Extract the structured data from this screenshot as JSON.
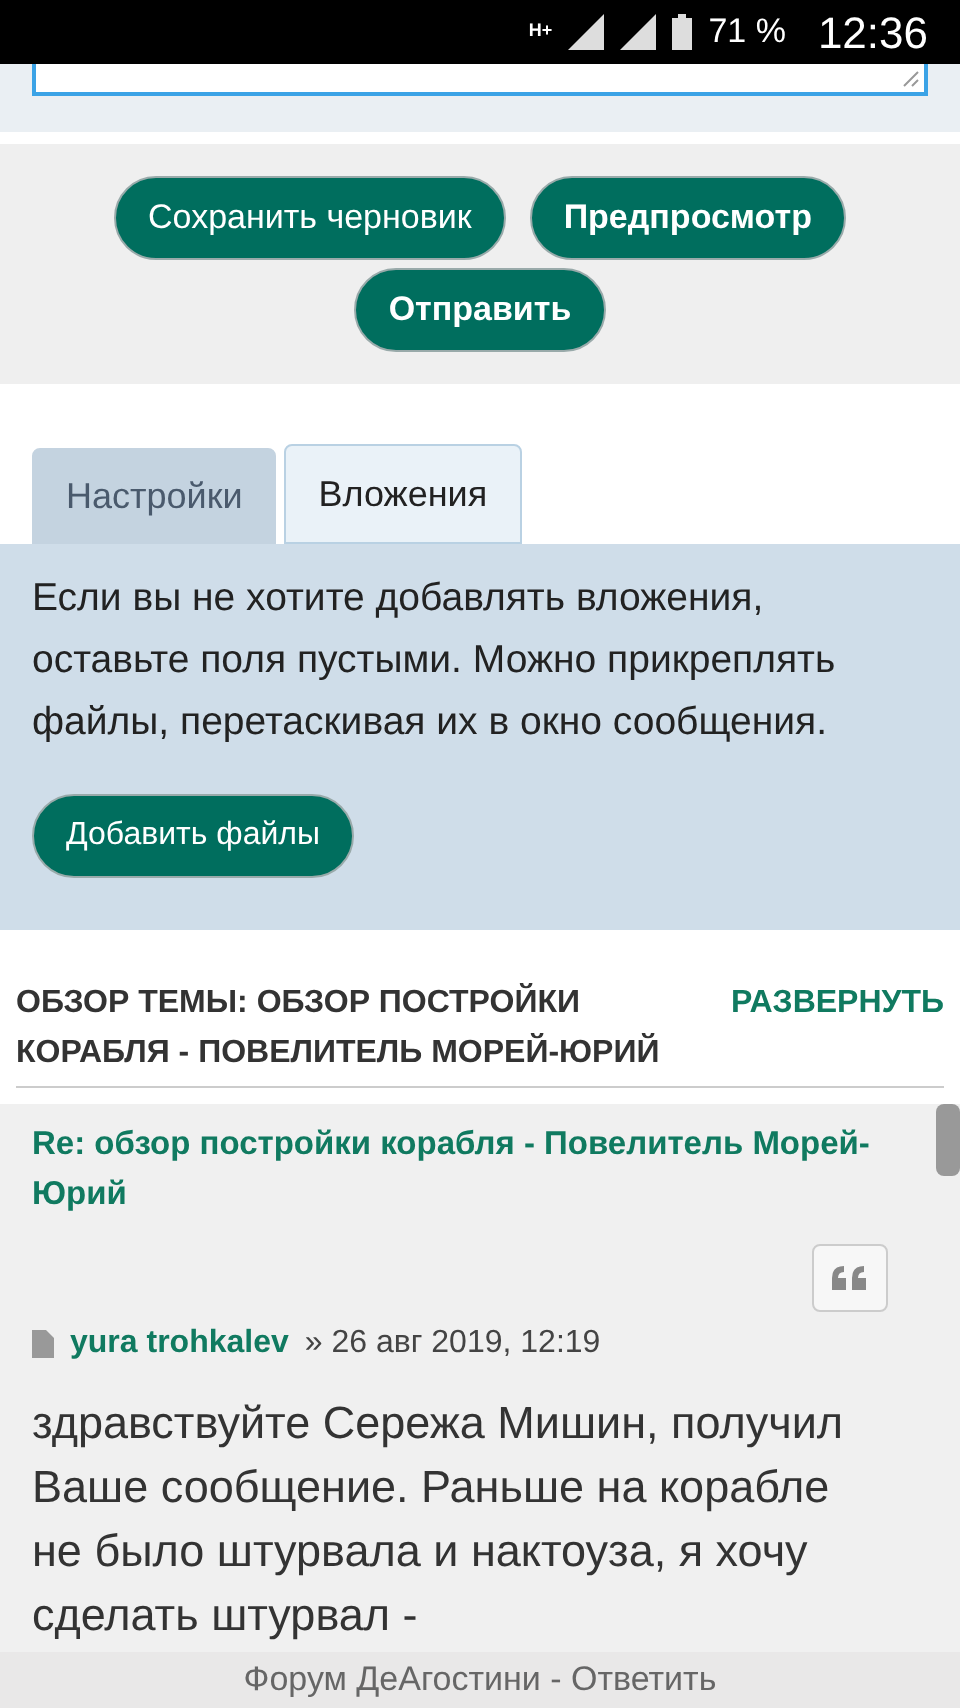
{
  "status_bar": {
    "network": "H+",
    "battery": "71 %",
    "time": "12:36"
  },
  "buttons": [
    {
      "label": "Сохранить черновик",
      "bold": false
    },
    {
      "label": "Предпросмотр",
      "bold": true
    },
    {
      "label": "Отправить",
      "bold": true
    }
  ],
  "tabs": [
    {
      "label": "Настройки",
      "selected": false
    },
    {
      "label": "Вложения",
      "selected": true
    }
  ],
  "attachments": {
    "text": "Если вы не хотите добавлять вложения, оставьте поля пустыми. Можно прикреплять файлы, перетаскивая их в окно сообщения.",
    "button": "Добавить файлы"
  },
  "topic": {
    "title": "ОБЗОР ТЕМЫ: ОБЗОР ПОСТРОЙКИ КОРАБЛЯ - ПОВЕЛИТЕЛЬ МОРЕЙ-ЮРИЙ",
    "expand": "РАЗВЕРНУТЬ"
  },
  "post": {
    "title": "Re: обзор постройки корабля - Повелитель Морей-Юрий",
    "author": "yura trohkalev",
    "date": "» 26 авг 2019, 12:19",
    "body": "здравствуйте Сережа Мишин, получил Ваше сообщение. Раньше на корабле не было штурвала и нактоуза, я хочу сделать штурвал -"
  },
  "footer": {
    "title": "Форум ДеАгостини - Ответить"
  }
}
